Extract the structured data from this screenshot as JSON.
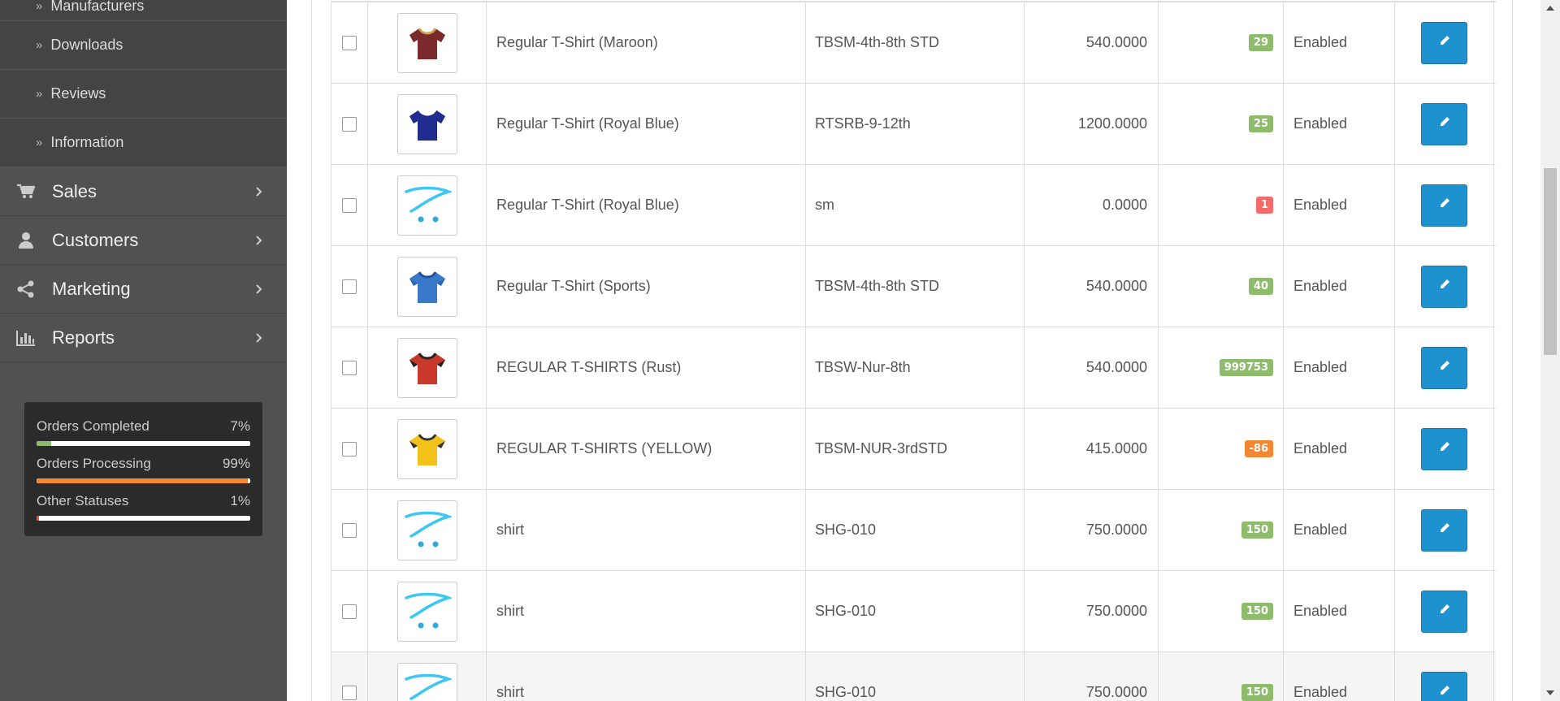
{
  "sidebar": {
    "sub_items": [
      {
        "label": "Manufacturers"
      },
      {
        "label": "Downloads"
      },
      {
        "label": "Reviews"
      },
      {
        "label": "Information"
      }
    ],
    "main_items": [
      {
        "label": "Sales",
        "icon": "cart-icon"
      },
      {
        "label": "Customers",
        "icon": "user-icon"
      },
      {
        "label": "Marketing",
        "icon": "share-icon"
      },
      {
        "label": "Reports",
        "icon": "bar-chart-icon"
      }
    ],
    "stats": [
      {
        "label": "Orders Completed",
        "value": "7%",
        "fraction": 0.07,
        "color": "#8fbb6c"
      },
      {
        "label": "Orders Processing",
        "value": "99%",
        "fraction": 0.99,
        "color": "#f38733"
      },
      {
        "label": "Other Statuses",
        "value": "1%",
        "fraction": 0.01,
        "color": "#e3503e"
      }
    ]
  },
  "products": [
    {
      "name": "Regular T-Shirt (Maroon)",
      "model": "TBSM-4th-8th STD",
      "price": "540.0000",
      "quantity": "29",
      "qty_color": "#8fbb6c",
      "status": "Enabled",
      "image": "maroon-tshirt"
    },
    {
      "name": "Regular T-Shirt (Royal Blue)",
      "model": "RTSRB-9-12th",
      "price": "1200.0000",
      "quantity": "25",
      "qty_color": "#8fbb6c",
      "status": "Enabled",
      "image": "royal-blue-tshirt"
    },
    {
      "name": "Regular T-Shirt (Royal Blue)",
      "model": "sm",
      "price": "0.0000",
      "quantity": "1",
      "qty_color": "#f56b6b",
      "status": "Enabled",
      "image": "placeholder-cart"
    },
    {
      "name": "Regular T-Shirt (Sports)",
      "model": "TBSM-4th-8th STD",
      "price": "540.0000",
      "quantity": "40",
      "qty_color": "#8fbb6c",
      "status": "Enabled",
      "image": "sports-tshirt"
    },
    {
      "name": "REGULAR T-SHIRTS (Rust)",
      "model": "TBSW-Nur-8th",
      "price": "540.0000",
      "quantity": "999753",
      "qty_color": "#8fbb6c",
      "status": "Enabled",
      "image": "rust-tshirt"
    },
    {
      "name": "REGULAR T-SHIRTS (YELLOW)",
      "model": "TBSM-NUR-3rdSTD",
      "price": "415.0000",
      "quantity": "-86",
      "qty_color": "#f38733",
      "status": "Enabled",
      "image": "yellow-tshirt"
    },
    {
      "name": "shirt",
      "model": "SHG-010",
      "price": "750.0000",
      "quantity": "150",
      "qty_color": "#8fbb6c",
      "status": "Enabled",
      "image": "placeholder-cart"
    },
    {
      "name": "shirt",
      "model": "SHG-010",
      "price": "750.0000",
      "quantity": "150",
      "qty_color": "#8fbb6c",
      "status": "Enabled",
      "image": "placeholder-cart"
    },
    {
      "name": "shirt",
      "model": "SHG-010",
      "price": "750.0000",
      "quantity": "150",
      "qty_color": "#8fbb6c",
      "status": "Enabled",
      "image": "placeholder-cart"
    }
  ]
}
